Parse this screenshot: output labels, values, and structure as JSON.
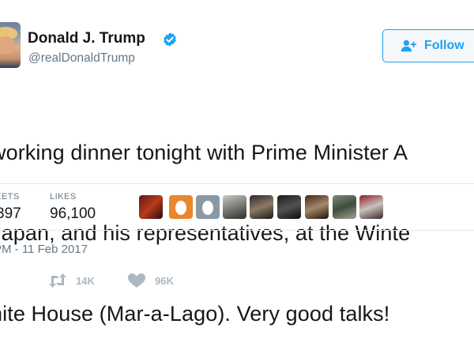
{
  "header": {
    "display_name": "Donald J. Trump",
    "handle": "@realDonaldTrump",
    "verified": true,
    "follow_label": "Follow"
  },
  "tweet": {
    "lines": [
      "working dinner tonight with Prime Minister A",
      "Japan, and his representatives, at the Winte",
      "nite House (Mar-a-Lago). Very good talks!"
    ]
  },
  "stats": {
    "retweets_label": "EETS",
    "retweets_value": "397",
    "likes_label": "LIKES",
    "likes_value": "96,100"
  },
  "liker_avatars": [
    "avatar-dark-red",
    "avatar-orange-egg",
    "avatar-gray-egg",
    "avatar-photo-1",
    "avatar-photo-2",
    "avatar-photo-3",
    "avatar-photo-4",
    "avatar-photo-5",
    "avatar-photo-6"
  ],
  "timestamp": "PM - 11 Feb 2017",
  "actions": {
    "retweet_count": "14K",
    "like_count": "96K"
  },
  "colors": {
    "brand_blue": "#1da1f2",
    "text_primary": "#14171a",
    "text_secondary": "#657786",
    "divider": "#e1e8ed",
    "action_gray": "#aab8c2"
  }
}
